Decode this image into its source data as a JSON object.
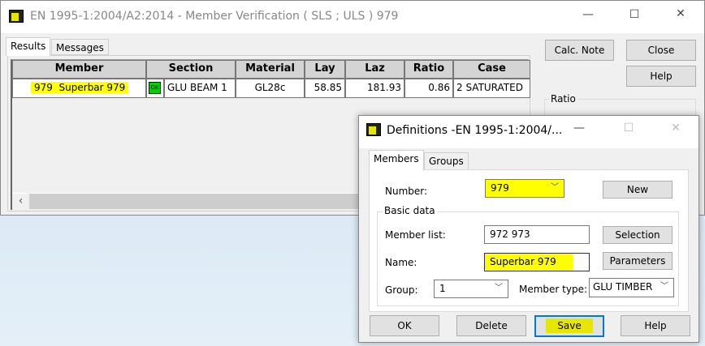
{
  "main_window": {
    "title": "EN 1995-1:2004/A2:2014 - Member Verification ( SLS ; ULS ) 979",
    "tabs": [
      "Results",
      "Messages"
    ],
    "table": {
      "columns": [
        "Member",
        "Section",
        "Material",
        "Lay",
        "Laz",
        "Ratio",
        "Case"
      ],
      "rows": [
        {
          "member": "979  Superbar 979",
          "status": "OK",
          "section": "GLU BEAM 1",
          "material": "GL28c",
          "lay": "58.85",
          "laz": "181.93",
          "ratio": "0.86",
          "case": "2 SATURATED"
        }
      ]
    },
    "buttons": {
      "calc_note": "Calc. Note",
      "close": "Close",
      "help": "Help"
    },
    "ratio_group": "Ratio"
  },
  "dialog": {
    "title": "Definitions -EN 1995-1:2004/...",
    "tabs": [
      "Members",
      "Groups"
    ],
    "number_label": "Number:",
    "number_value": "979",
    "new": "New",
    "basic_data": "Basic data",
    "member_list_label": "Member list:",
    "member_list_value": "972 973",
    "selection": "Selection",
    "name_label": "Name:",
    "name_value": "Superbar 979",
    "parameters": "Parameters",
    "group_label": "Group:",
    "group_value": "1",
    "member_type_label": "Member type:",
    "member_type_value": "GLU TIMBER",
    "buttons": {
      "ok": "OK",
      "delete": "Delete",
      "save": "Save",
      "help": "Help"
    }
  },
  "colors": {
    "highlight": "#ffff00",
    "ok_badge": "#00d000",
    "focus": "#0078d7"
  }
}
